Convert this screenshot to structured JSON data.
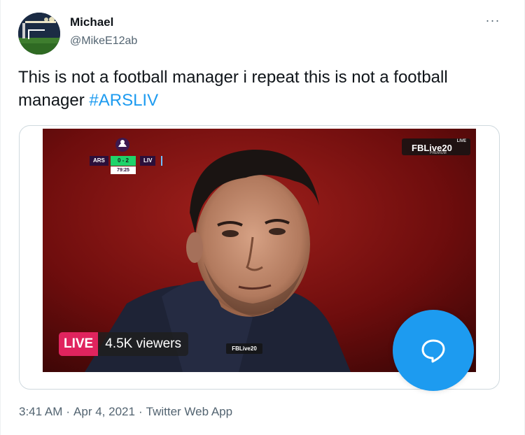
{
  "user": {
    "name": "Michael",
    "handle": "@MikeE12ab"
  },
  "more_icon": "more-horizontal-icon",
  "tweet": {
    "text": "This is not a football manager i repeat this is not a football manager ",
    "hashtag": "#ARSLIV"
  },
  "video": {
    "scorebug": {
      "home": "ARS",
      "score": "0 - 2",
      "away": "LIV",
      "clock": "79:25"
    },
    "watermark_top": {
      "label_live": "LIVE",
      "brand": "FBLive20",
      "sub": "PREMIUM"
    },
    "live_badge": "LIVE",
    "viewers": "4.5K viewers",
    "watermark_bottom": "FBLive20"
  },
  "fab_icon": "chat-bubble-icon",
  "meta": {
    "time": "3:41 AM",
    "sep1": "·",
    "date": "Apr 4, 2021",
    "sep2": "·",
    "client": "Twitter Web App"
  },
  "colors": {
    "accent": "#1d9bf0",
    "live_red": "#e0245e",
    "secondary_text": "#536471"
  }
}
